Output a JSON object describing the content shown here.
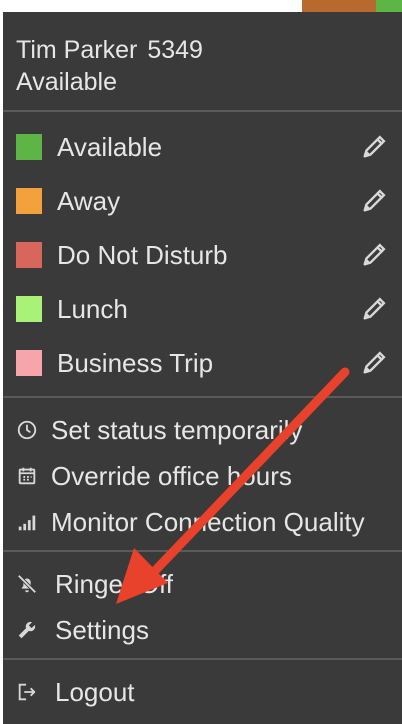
{
  "user": {
    "name": "Tim Parker",
    "extension": "5349",
    "status": "Available"
  },
  "statuses": [
    {
      "label": "Available",
      "color": "#5cb545",
      "icon": "pencil-icon"
    },
    {
      "label": "Away",
      "color": "#f2a13c",
      "icon": "pencil-icon"
    },
    {
      "label": "Do Not Disturb",
      "color": "#d8665a",
      "icon": "pencil-icon"
    },
    {
      "label": "Lunch",
      "color": "#a8f278",
      "icon": "pencil-icon"
    },
    {
      "label": "Business Trip",
      "color": "#f6a6ab",
      "icon": "pencil-icon"
    }
  ],
  "menu": {
    "set_status_temporarily": {
      "label": "Set status temporarily",
      "icon": "clock-icon"
    },
    "override_office_hours": {
      "label": "Override office hours",
      "icon": "calendar-icon"
    },
    "monitor_connection_quality": {
      "label": "Monitor Connection Quality",
      "icon": "signal-bars-icon"
    },
    "ringer_off": {
      "label": "Ringer Off",
      "icon": "bell-off-icon"
    },
    "settings": {
      "label": "Settings",
      "icon": "wrench-icon"
    },
    "logout": {
      "label": "Logout",
      "icon": "logout-icon"
    }
  },
  "colors": {
    "panel_bg": "#3a3a3a",
    "divider": "#5b5b5b",
    "text": "#e6e6e6",
    "annotation_arrow": "#e8412c",
    "avatar_accent": "#5cb545"
  }
}
